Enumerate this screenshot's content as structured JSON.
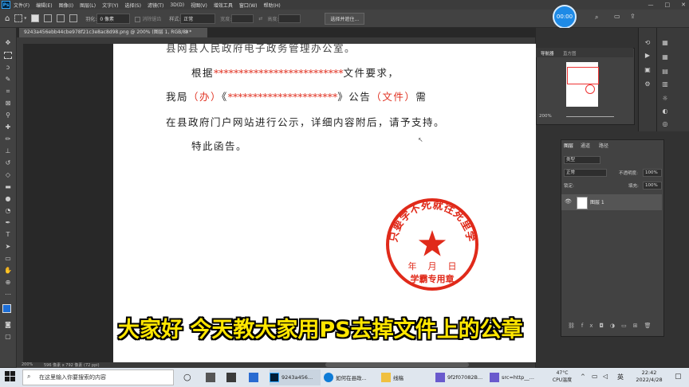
{
  "menu": {
    "logo": "Ps",
    "items": [
      "文件(F)",
      "编辑(E)",
      "图像(I)",
      "图层(L)",
      "文字(Y)",
      "选择(S)",
      "滤镜(T)",
      "3D(D)",
      "视图(V)",
      "增效工具",
      "窗口(W)",
      "帮助(H)"
    ]
  },
  "options": {
    "feather_label": "羽化:",
    "feather_value": "0 像素",
    "antialias_label": "消除锯齿",
    "style_label": "样式:",
    "style_value": "正常",
    "width_label": "宽度:",
    "height_label": "高度:",
    "select_mask_button": "选择并遮住..."
  },
  "timer": "00:00",
  "document": {
    "tab_title": "9243a456ebb44cbe978f21c3e8ac8d98.png @ 200% (图层 1, RGB/8) *",
    "line0": "县网县人民政府电子政务管理办公室。",
    "line1_a": "根据",
    "line1_stars": "**************************",
    "line1_b": "文件要求，",
    "line2_a": "我局",
    "line2_ban": "（办）",
    "line2_quote_open": "《",
    "line2_stars": "**********************",
    "line2_quote_close": "》公告",
    "line2_wenjian": "（文件）",
    "line2_end": "需",
    "line3": "在县政府门户网站进行公示，详细内容附后，请予支持。",
    "line4": "特此函告。",
    "stamp": {
      "ring_text": "只要学不死就往死里学",
      "date_text": "年    月    日",
      "bottom_text": "学霸专用章"
    },
    "status": "596 像素 x 792 像素 (72 ppi)",
    "zoom": "200%"
  },
  "subtitle": "大家好 今天教大家用PS去掉文件上的公章",
  "navigator": {
    "tabs": [
      "导航器",
      "直方图"
    ],
    "zoom": "200%"
  },
  "layers": {
    "tabs": [
      "图层",
      "通道",
      "路径"
    ],
    "kind": "类型",
    "blend_mode": "正常",
    "opacity_label": "不透明度:",
    "opacity_value": "100%",
    "lock_label": "锁定:",
    "fill_label": "填充:",
    "fill_value": "100%",
    "layer_name": "图层 1"
  },
  "taskbar": {
    "search_placeholder": "在这里输入你要搜索的内容",
    "apps": [
      {
        "label": "9243a456..."
      },
      {
        "label": "如何在县政..."
      },
      {
        "label": "线稿"
      },
      {
        "label": "9f2f07082B..."
      },
      {
        "label": "src=http__..."
      }
    ],
    "weather_temp": "47°C",
    "weather_label": "CPU温度",
    "ime": "英",
    "time": "22:42",
    "date": "2022/4/28"
  },
  "colors": {
    "stamp_red": "#e02a1a",
    "subtitle_yellow": "#ffe600",
    "ps_blue": "#31a8ff"
  }
}
